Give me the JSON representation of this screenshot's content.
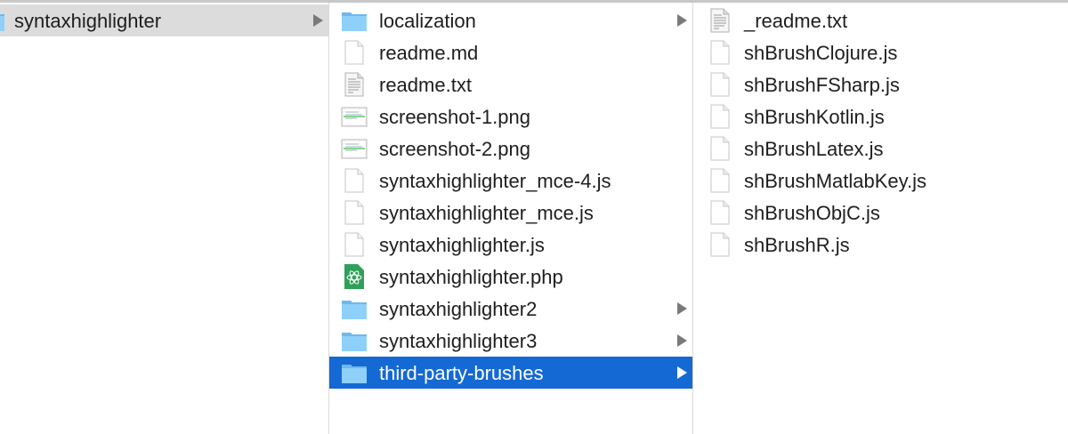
{
  "columns": [
    {
      "items": [
        {
          "name": "syntaxhighlighter",
          "type": "folder",
          "expandable": true,
          "selected": "gray"
        }
      ]
    },
    {
      "items": [
        {
          "name": "localization",
          "type": "folder",
          "expandable": true
        },
        {
          "name": "readme.md",
          "type": "blank"
        },
        {
          "name": "readme.txt",
          "type": "text"
        },
        {
          "name": "screenshot-1.png",
          "type": "image"
        },
        {
          "name": "screenshot-2.png",
          "type": "image"
        },
        {
          "name": "syntaxhighlighter_mce-4.js",
          "type": "blank"
        },
        {
          "name": "syntaxhighlighter_mce.js",
          "type": "blank"
        },
        {
          "name": "syntaxhighlighter.js",
          "type": "blank"
        },
        {
          "name": "syntaxhighlighter.php",
          "type": "php"
        },
        {
          "name": "syntaxhighlighter2",
          "type": "folder",
          "expandable": true
        },
        {
          "name": "syntaxhighlighter3",
          "type": "folder",
          "expandable": true
        },
        {
          "name": "third-party-brushes",
          "type": "folder",
          "expandable": true,
          "selected": "blue"
        }
      ]
    },
    {
      "items": [
        {
          "name": "_readme.txt",
          "type": "text"
        },
        {
          "name": "shBrushClojure.js",
          "type": "blank"
        },
        {
          "name": "shBrushFSharp.js",
          "type": "blank"
        },
        {
          "name": "shBrushKotlin.js",
          "type": "blank"
        },
        {
          "name": "shBrushLatex.js",
          "type": "blank"
        },
        {
          "name": "shBrushMatlabKey.js",
          "type": "blank"
        },
        {
          "name": "shBrushObjC.js",
          "type": "blank"
        },
        {
          "name": "shBrushR.js",
          "type": "blank"
        }
      ]
    }
  ],
  "colors": {
    "selection": "#1469d4",
    "inactive_selection": "#dcdcdc",
    "folder": "#7cc4f4"
  }
}
